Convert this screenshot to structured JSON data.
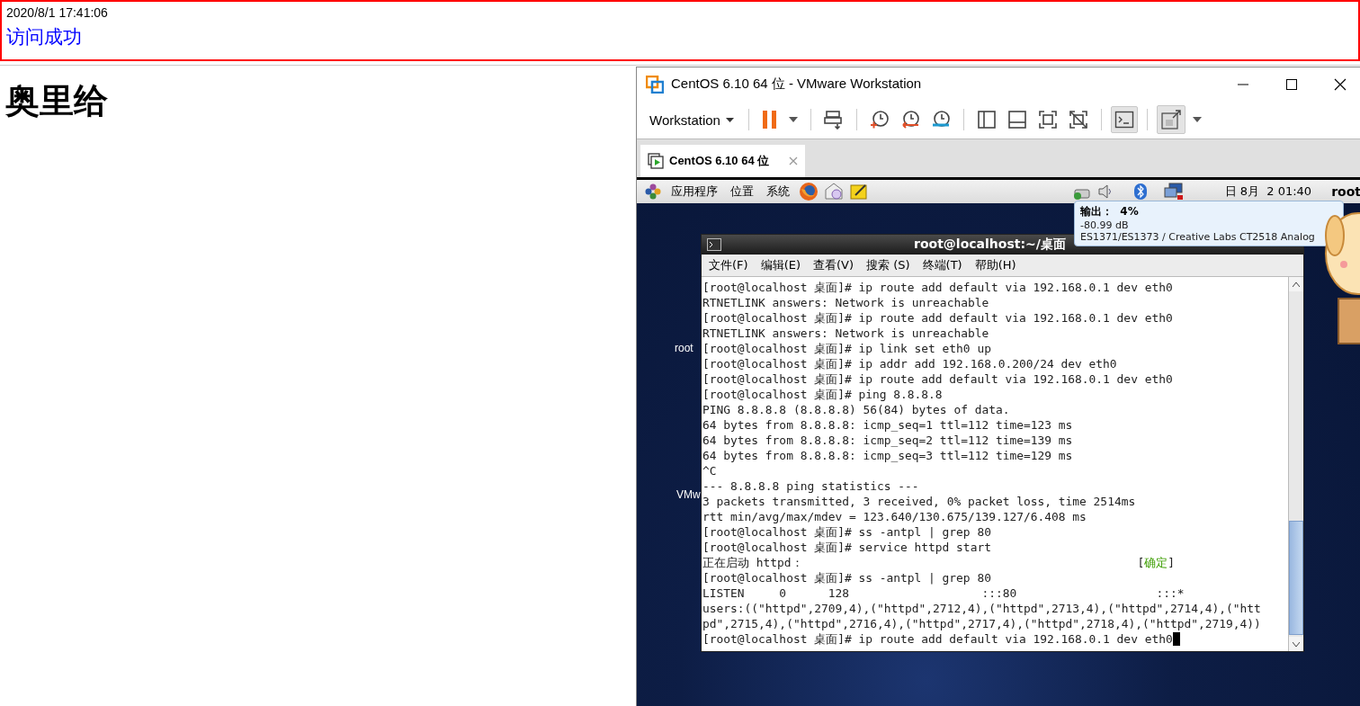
{
  "banner": {
    "timestamp": "2020/8/1 17:41:06",
    "message": "访问成功"
  },
  "heading": "奥里给",
  "vm_window": {
    "title": "CentOS 6.10 64 位 - VMware Workstation",
    "toolbar": {
      "menu_label": "Workstation"
    },
    "tabs": [
      {
        "label": "CentOS 6.10 64 位"
      }
    ],
    "guest": {
      "panel": {
        "menus": [
          "应用程序",
          "位置",
          "系统"
        ],
        "clock": "日 8月  2 01:40",
        "user": "root"
      },
      "desktop_icons": [
        "root",
        "VMw"
      ],
      "tooltip": {
        "title": "输出：  4%",
        "lines": [
          "-80.99 dB",
          "ES1371/ES1373 / Creative Labs CT2518 Analog"
        ]
      },
      "terminal": {
        "title": "root@localhost:~/桌面",
        "menu": [
          "文件(F)",
          "编辑(E)",
          "查看(V)",
          "搜索 (S)",
          "终端(T)",
          "帮助(H)"
        ],
        "lines": [
          {
            "text": "[root@localhost 桌面]# ip route add default via 192.168.0.1 dev eth0"
          },
          {
            "text": "RTNETLINK answers: Network is unreachable"
          },
          {
            "text": "[root@localhost 桌面]# ip route add default via 192.168.0.1 dev eth0"
          },
          {
            "text": "RTNETLINK answers: Network is unreachable"
          },
          {
            "text": "[root@localhost 桌面]# ip link set eth0 up"
          },
          {
            "text": "[root@localhost 桌面]# ip addr add 192.168.0.200/24 dev eth0"
          },
          {
            "text": "[root@localhost 桌面]# ip route add default via 192.168.0.1 dev eth0"
          },
          {
            "text": "[root@localhost 桌面]# ping 8.8.8.8"
          },
          {
            "text": "PING 8.8.8.8 (8.8.8.8) 56(84) bytes of data."
          },
          {
            "text": "64 bytes from 8.8.8.8: icmp_seq=1 ttl=112 time=123 ms"
          },
          {
            "text": "64 bytes from 8.8.8.8: icmp_seq=2 ttl=112 time=139 ms"
          },
          {
            "text": "64 bytes from 8.8.8.8: icmp_seq=3 ttl=112 time=129 ms"
          },
          {
            "text": "^C"
          },
          {
            "text": "--- 8.8.8.8 ping statistics ---"
          },
          {
            "text": "3 packets transmitted, 3 received, 0% packet loss, time 2514ms"
          },
          {
            "text": "rtt min/avg/max/mdev = 123.640/130.675/139.127/6.408 ms"
          },
          {
            "text": "[root@localhost 桌面]# ss -antpl | grep 80"
          },
          {
            "text": "[root@localhost 桌面]# service httpd start"
          },
          {
            "text": "正在启动 httpd：",
            "status": [
              "[",
              "确定",
              "]"
            ]
          },
          {
            "text": "[root@localhost 桌面]# ss -antpl | grep 80"
          },
          {
            "text": "LISTEN     0      128                   :::80                    :::*"
          },
          {
            "text": "users:((\"httpd\",2709,4),(\"httpd\",2712,4),(\"httpd\",2713,4),(\"httpd\",2714,4),(\"htt"
          },
          {
            "text": "pd\",2715,4),(\"httpd\",2716,4),(\"httpd\",2717,4),(\"httpd\",2718,4),(\"httpd\",2719,4))"
          },
          {
            "text": "[root@localhost 桌面]# ip route add default via 192.168.0.1 dev eth0",
            "cursor": true
          }
        ]
      }
    }
  }
}
